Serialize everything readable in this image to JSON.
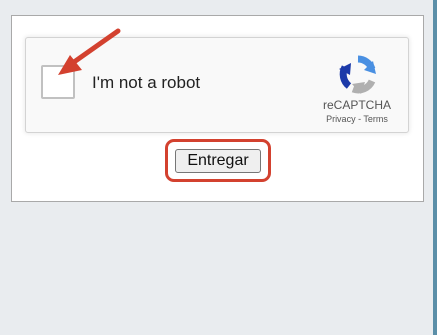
{
  "captcha": {
    "checkbox_checked": false,
    "label": "I'm not a robot",
    "brand": "reCAPTCHA",
    "privacy_link": "Privacy",
    "separator": " - ",
    "terms_link": "Terms",
    "logo_icon": "recaptcha-logo-icon"
  },
  "form": {
    "submit_label": "Entregar"
  },
  "annotations": {
    "arrow_icon": "arrow-pointer-icon",
    "highlight_color": "#d3412f"
  },
  "colors": {
    "background": "#e9ecef",
    "accent_blue": "#4a90e2",
    "logo_dark_blue": "#1c3aa9",
    "logo_gray": "#b0b0b0",
    "right_edge": "#5b8fa8"
  }
}
